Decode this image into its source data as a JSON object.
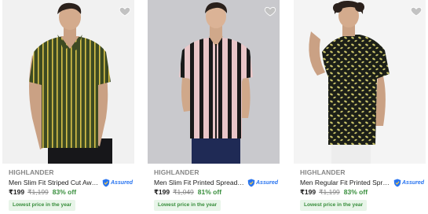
{
  "products": [
    {
      "brand": "HIGHLANDER",
      "title": "Men Slim Fit Striped Cut Away C...",
      "assured": "Assured",
      "price": "₹199",
      "mrp": "₹1,199",
      "discount": "83% off",
      "badge": "Lowest price in the year",
      "image": "man-olive-yellow-striped-shirt",
      "shirt_colors": [
        "#3d4a22",
        "#d9c24a"
      ]
    },
    {
      "brand": "HIGHLANDER",
      "title": "Men Slim Fit Printed Spread Coll...",
      "assured": "Assured",
      "price": "₹199",
      "mrp": "₹1,049",
      "discount": "81% off",
      "badge": "Lowest price in the year",
      "image": "man-pink-black-striped-shirt",
      "shirt_colors": [
        "#e9c6c8",
        "#1a1a1a"
      ]
    },
    {
      "brand": "HIGHLANDER",
      "title": "Men Regular Fit Printed Spread ...",
      "assured": "Assured",
      "price": "₹199",
      "mrp": "₹1,199",
      "discount": "83% off",
      "badge": "Lowest price in the year",
      "image": "man-black-yellow-printed-shirt",
      "shirt_colors": [
        "#1c1f18",
        "#c9c36a"
      ]
    }
  ],
  "colors": {
    "price_green": "#388e3c",
    "muted_grey": "#878787",
    "assured_blue": "#2874f0",
    "badge_bg": "#e8f5e9"
  }
}
